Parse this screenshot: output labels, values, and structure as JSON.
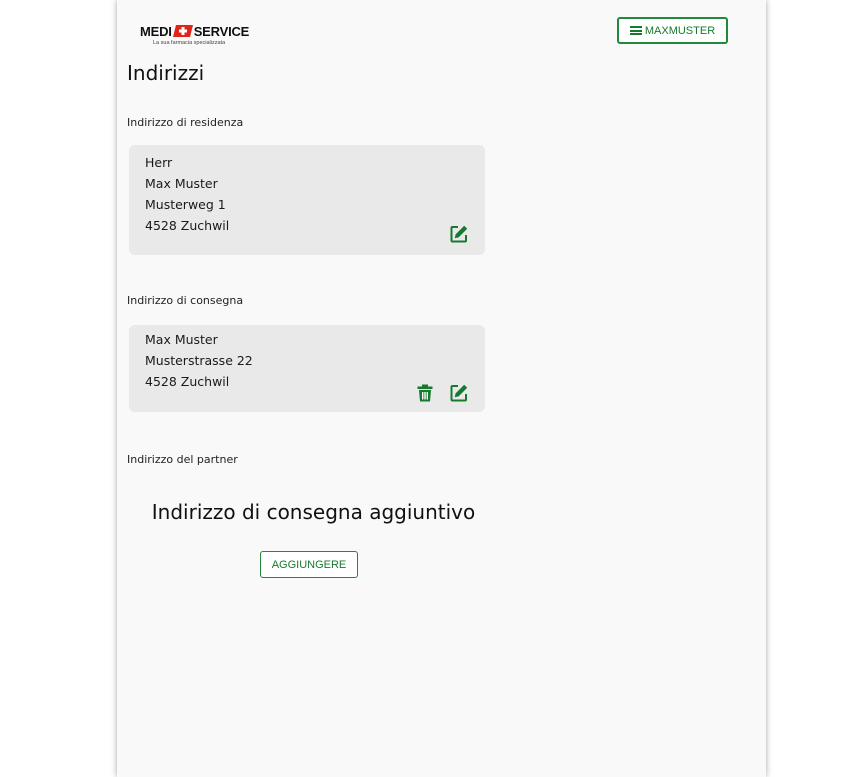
{
  "brand": {
    "left_word": "MEDI",
    "right_word": "SERVICE",
    "tagline": "La sua farmacia specializzata",
    "colors": {
      "accent": "#1f8a3a",
      "logo_red": "#e2231a"
    }
  },
  "header": {
    "menu_icon": "hamburger-icon",
    "menu_label": "MAXMUSTER"
  },
  "page_title": "Indirizzi",
  "residence": {
    "label": "Indirizzo di residenza",
    "lines": [
      "Herr",
      "Max Muster",
      "Musterweg 1",
      "4528 Zuchwil"
    ],
    "edit_icon": "edit-icon"
  },
  "delivery": {
    "label": "Indirizzo di consegna",
    "lines": [
      "Max Muster",
      "Musterstrasse 22",
      "4528 Zuchwil"
    ],
    "delete_icon": "trash-icon",
    "edit_icon": "edit-icon"
  },
  "partner": {
    "label": "Indirizzo del partner"
  },
  "additional": {
    "heading": "Indirizzo di consegna aggiuntivo",
    "add_label": "AGGIUNGERE"
  }
}
